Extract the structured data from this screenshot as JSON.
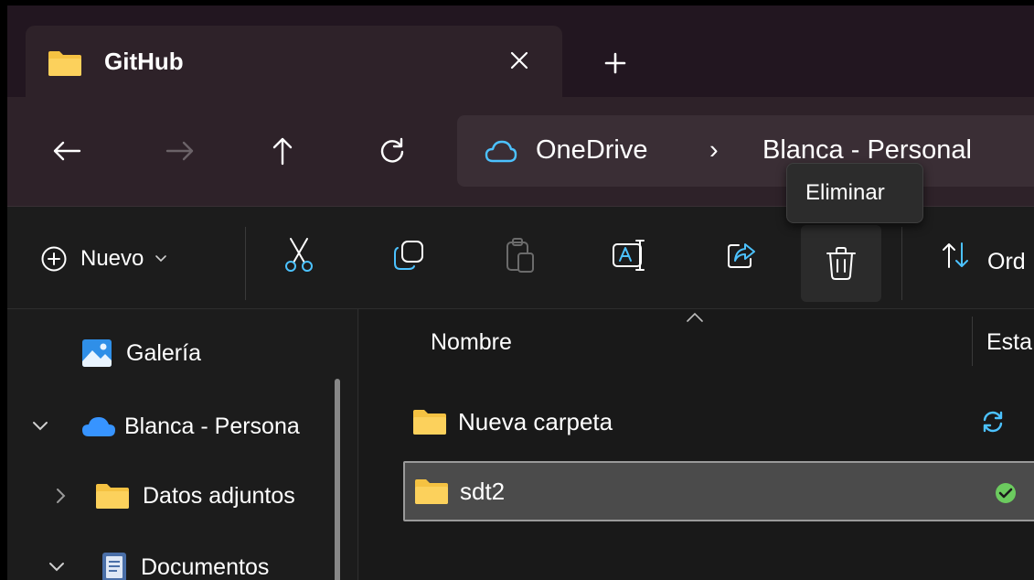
{
  "tab": {
    "title": "GitHub",
    "close_glyph": "✕",
    "new_glyph": "+"
  },
  "nav": {
    "back": "←",
    "forward": "→",
    "up": "↑",
    "refresh": "↻"
  },
  "address": {
    "segments": [
      "OneDrive",
      "Blanca - Personal"
    ],
    "separator": "›"
  },
  "toolbar": {
    "new_label": "Nuevo",
    "sort_label": "Ord"
  },
  "tooltip": {
    "text": "Eliminar"
  },
  "sidebar": {
    "items": [
      {
        "label": "Galería",
        "icon": "gallery-icon"
      },
      {
        "label": "Blanca - Persona",
        "icon": "onedrive-cloud-icon",
        "chevron": "expanded"
      },
      {
        "label": "Datos adjuntos",
        "icon": "folder-icon",
        "chevron": "collapsed"
      },
      {
        "label": "Documentos",
        "icon": "document-icon",
        "chevron": "expanded"
      }
    ]
  },
  "files": {
    "columns": {
      "name": "Nombre",
      "status": "Esta"
    },
    "rows": [
      {
        "name": "Nueva carpeta",
        "status": "sync-pending-icon"
      },
      {
        "name": "sdt2",
        "status": "available-check-icon"
      }
    ]
  },
  "colors": {
    "accent": "#4cc2ff",
    "folder": "#f5c242",
    "check": "#6ccb5f",
    "titlebar": "#221620"
  }
}
